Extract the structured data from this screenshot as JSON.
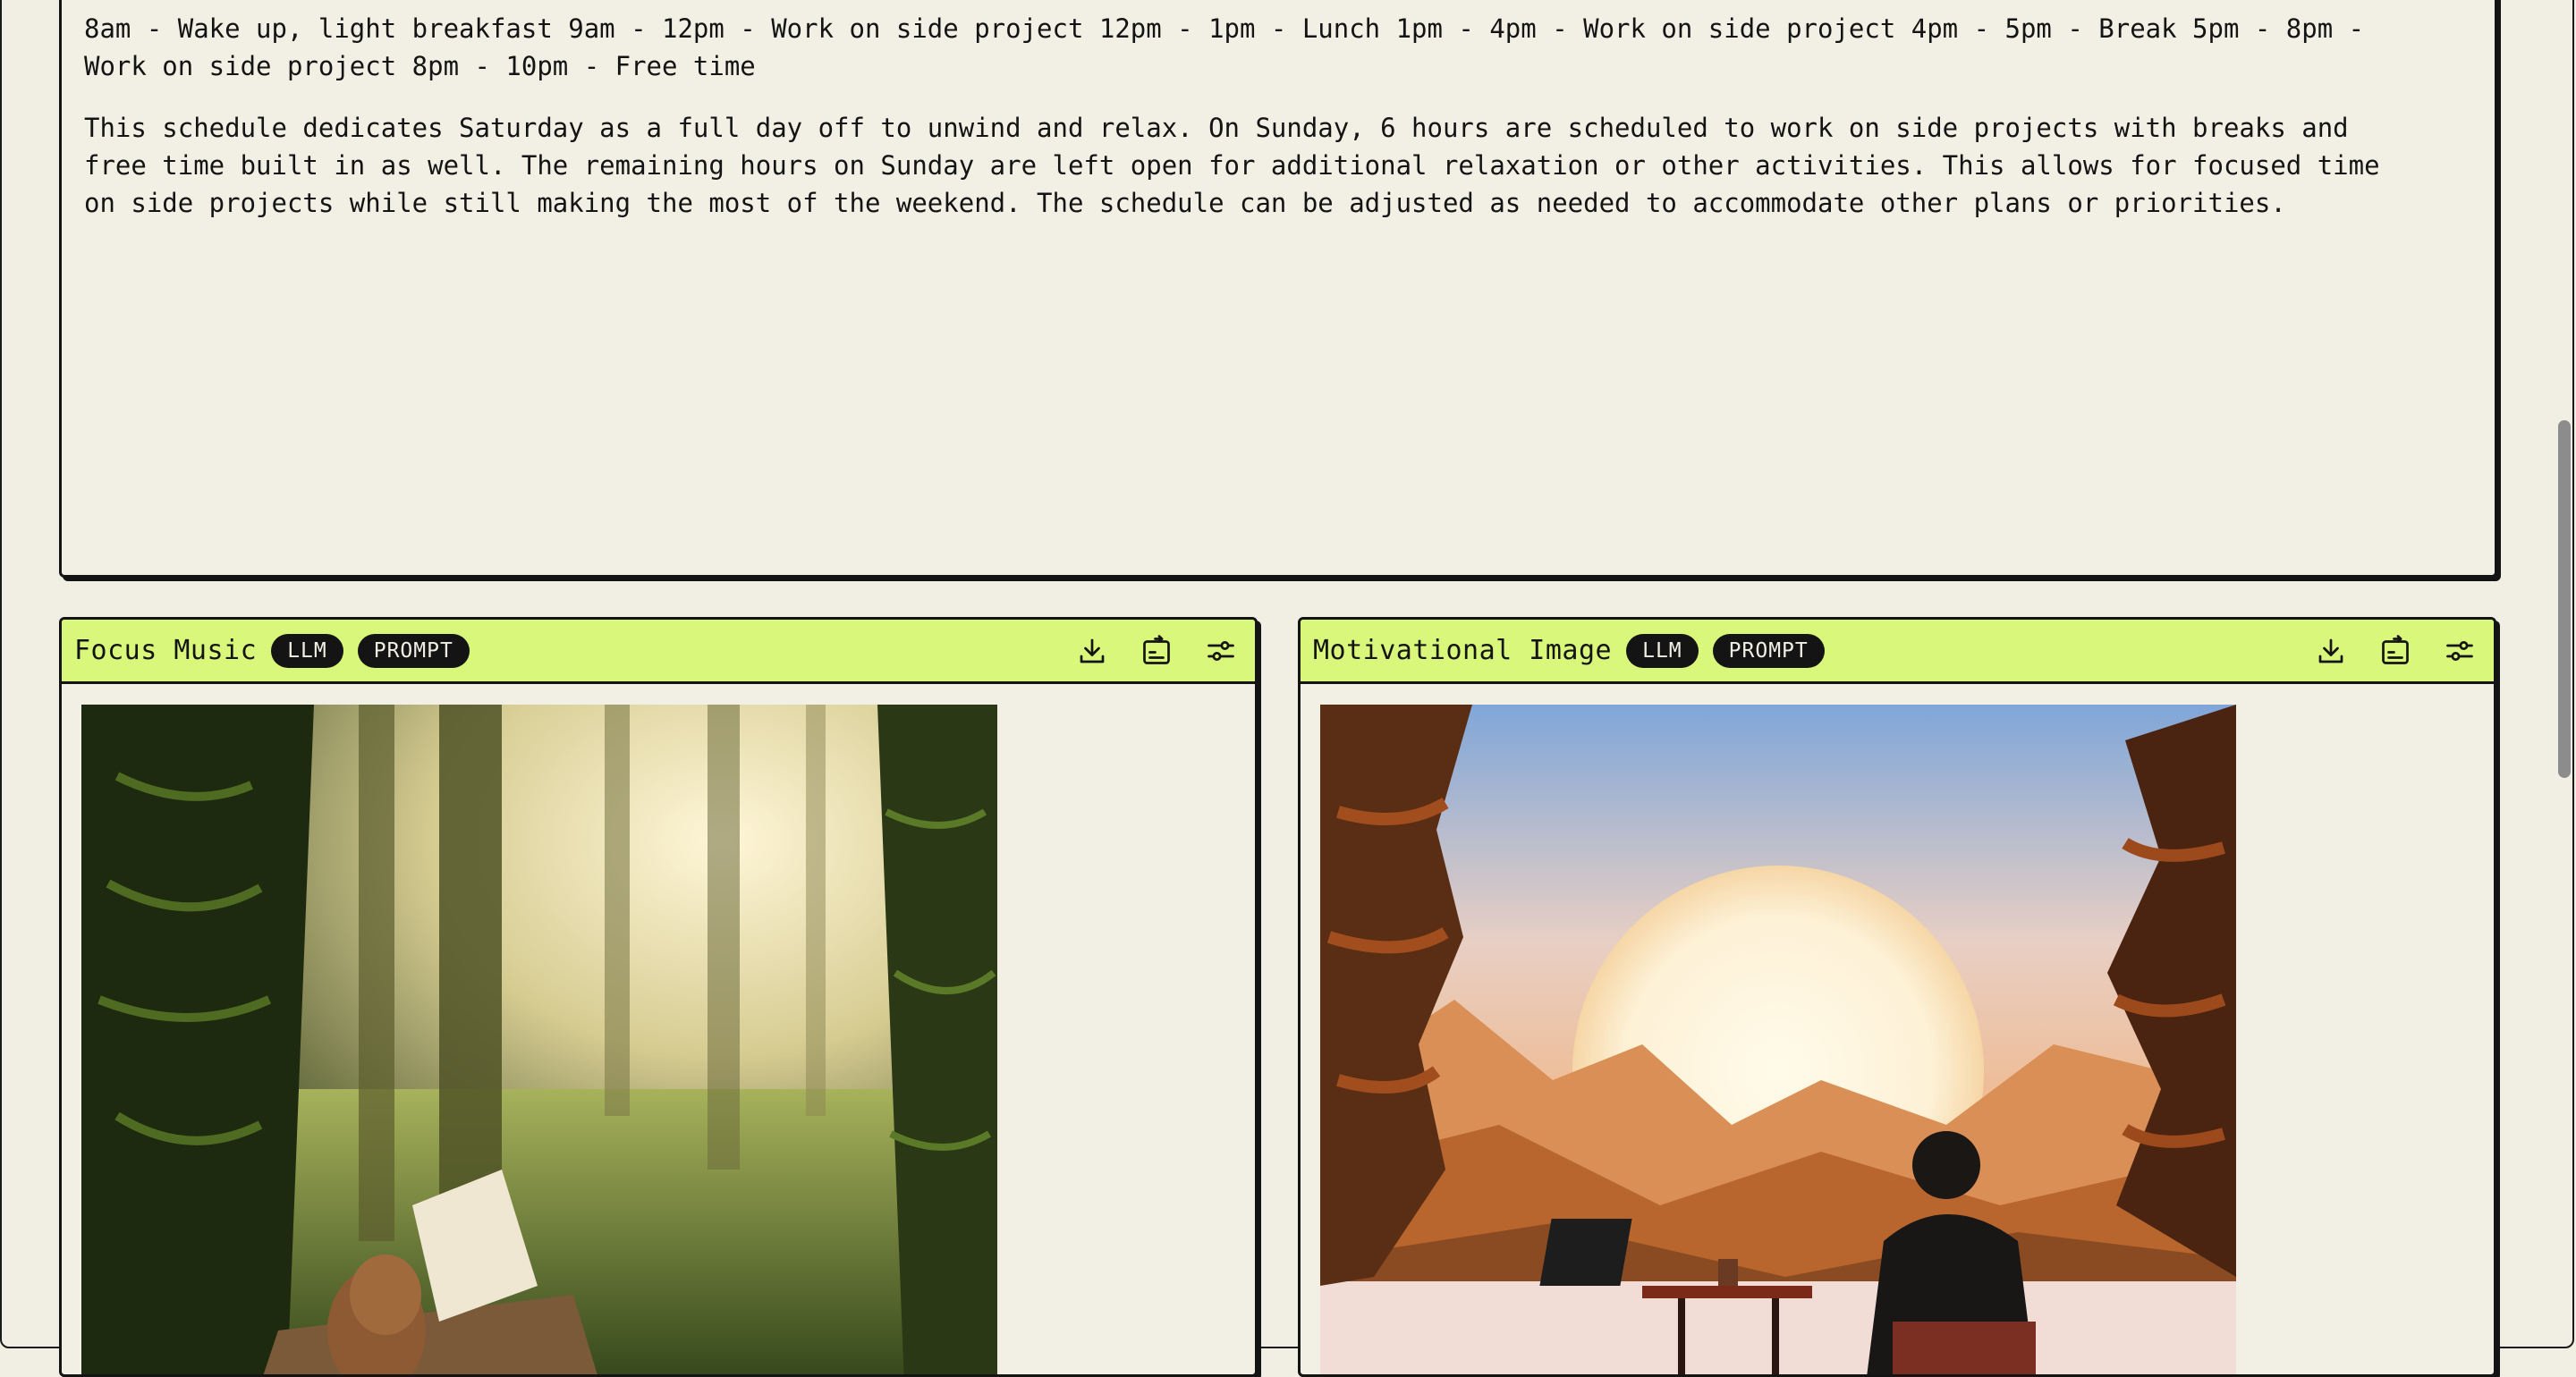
{
  "schedule_card": {
    "paragraphs": [
      "8am - Wake up, light breakfast 9am - 12pm - Work on side project 12pm - 1pm - Lunch 1pm - 4pm - Work on side project 4pm - 5pm - Break 5pm - 8pm - Work on side project 8pm - 10pm - Free time",
      "This schedule dedicates Saturday as a full day off to unwind and relax. On Sunday, 6 hours are scheduled to work on side projects with breaks and free time built in as well. The remaining hours on Sunday are left open for additional relaxation or other activities. This allows for focused time on side projects while still making the most of the weekend. The schedule can be adjusted as needed to accommodate other plans or priorities."
    ]
  },
  "cards": [
    {
      "title": "Focus Music",
      "badges": [
        "LLM",
        "PROMPT"
      ],
      "icons": [
        "download-icon",
        "share-icon",
        "settings-sliders-icon"
      ],
      "image": "forest-piano-image"
    },
    {
      "title": "Motivational Image",
      "badges": [
        "LLM",
        "PROMPT"
      ],
      "icons": [
        "download-icon",
        "share-icon",
        "settings-sliders-icon"
      ],
      "image": "sunset-laptop-image"
    }
  ],
  "colors": {
    "background": "#f1efe4",
    "header_accent": "#d9f77a",
    "ink": "#141414"
  }
}
